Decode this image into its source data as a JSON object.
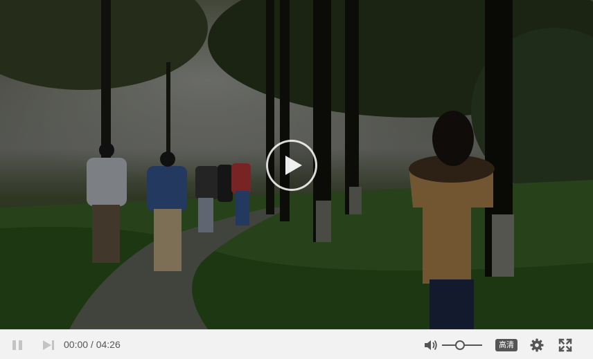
{
  "player": {
    "current_time": "00:00",
    "separator": " / ",
    "duration": "04:26",
    "quality_label": "高清",
    "volume_level": 0.45,
    "state": "paused"
  },
  "icons": {
    "big_play": "play-icon",
    "pause": "pause-icon",
    "next": "next-icon",
    "volume": "volume-icon",
    "settings": "gear-icon",
    "fullscreen": "fullscreen-icon"
  },
  "colors": {
    "control_bar": "#f2f2f2",
    "icon_gray": "#b8b8b8",
    "icon_dark": "#555555"
  }
}
